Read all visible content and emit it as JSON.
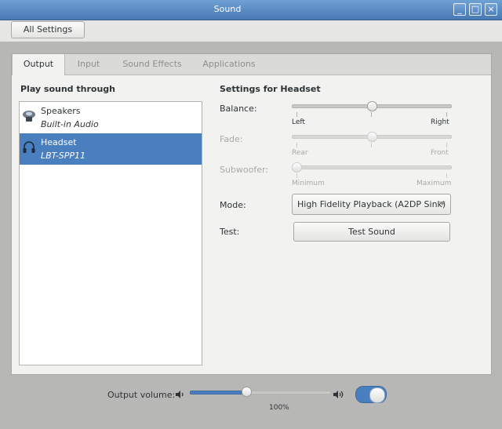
{
  "window": {
    "title": "Sound"
  },
  "toolbar": {
    "all_settings_label": "All Settings"
  },
  "tabs": [
    {
      "label": "Output",
      "active": true
    },
    {
      "label": "Input",
      "active": false
    },
    {
      "label": "Sound Effects",
      "active": false
    },
    {
      "label": "Applications",
      "active": false
    }
  ],
  "output": {
    "play_through_heading": "Play sound through",
    "devices": [
      {
        "name": "Speakers",
        "description": "Built-in Audio",
        "icon": "speaker-icon",
        "selected": false
      },
      {
        "name": "Headset",
        "description": "LBT-SPP11",
        "icon": "headset-icon",
        "selected": true
      }
    ],
    "settings_heading": "Settings for Headset",
    "balance": {
      "label": "Balance:",
      "left": "Left",
      "right": "Right",
      "value": 0.5
    },
    "fade": {
      "label": "Fade:",
      "left": "Rear",
      "right": "Front",
      "value": 0.5,
      "enabled": false
    },
    "subwoofer": {
      "label": "Subwoofer:",
      "left": "Minimum",
      "right": "Maximum",
      "value": 0.0,
      "enabled": false
    },
    "mode": {
      "label": "Mode:",
      "value": "High Fidelity Playback (A2DP Sink)"
    },
    "test": {
      "label": "Test:",
      "button_label": "Test Sound"
    }
  },
  "volume": {
    "label": "Output volume:",
    "level_percent": 40,
    "mark_label": "100%",
    "mute_on": true
  },
  "colors": {
    "accent": "#4a7fbf",
    "titlebar": "#5a8cc6"
  }
}
